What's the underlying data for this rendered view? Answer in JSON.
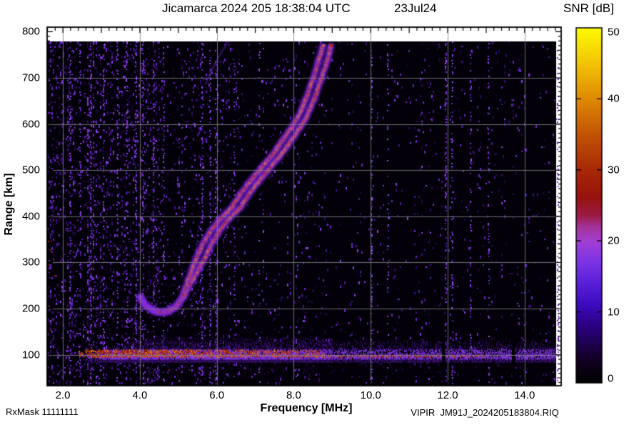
{
  "header": {
    "title": "Jicamarca 2024 205 18:38:04 UTC",
    "date": "23Jul24"
  },
  "footer": {
    "rx_mask": "RxMask 11111111",
    "file_label": "VIPIR  JM91J_2024205183804.RIQ"
  },
  "chart_data": {
    "type": "heatmap",
    "title": "Jicamarca 2024 205 18:38:04 UTC",
    "date_label": "23Jul24",
    "xlabel": "Frequency [MHz]",
    "ylabel": "Range [km]",
    "colorbar_label": "SNR [dB]",
    "xlim": [
      1.59,
      14.95
    ],
    "ylim": [
      33,
      810
    ],
    "clim": [
      0,
      50
    ],
    "grid": true,
    "x_tick_values": [
      2,
      4,
      6,
      8,
      10,
      12,
      14
    ],
    "x_tick_labels": [
      "2.0",
      "4.0",
      "6.0",
      "8.0",
      "10.0",
      "12.0",
      "14.0"
    ],
    "x_minor_tick_step": 0.2,
    "y_tick_values": [
      100,
      200,
      300,
      400,
      500,
      600,
      700,
      800
    ],
    "y_tick_labels": [
      "100",
      "200",
      "300",
      "400",
      "500",
      "600",
      "700",
      "800"
    ],
    "y_minor_tick_step": 10,
    "colorbar_tick_values": [
      0,
      10,
      20,
      30,
      40,
      50
    ],
    "colorbar_tick_labels": [
      "0",
      "10",
      "20",
      "30",
      "40",
      "50"
    ],
    "colormap_stops": [
      [
        0.0,
        "#000000"
      ],
      [
        0.07,
        "#140028"
      ],
      [
        0.16,
        "#2a0080"
      ],
      [
        0.22,
        "#3d0bbf"
      ],
      [
        0.28,
        "#5a1fd8"
      ],
      [
        0.34,
        "#7c34e6"
      ],
      [
        0.4,
        "#a23fd4"
      ],
      [
        0.44,
        "#a53296"
      ],
      [
        0.47,
        "#9c1c48"
      ],
      [
        0.52,
        "#96120e"
      ],
      [
        0.6,
        "#a92806"
      ],
      [
        0.7,
        "#c25404"
      ],
      [
        0.8,
        "#df8a04"
      ],
      [
        0.9,
        "#f3c406"
      ],
      [
        1.0,
        "#fdfb02"
      ]
    ],
    "data_extent": {
      "f_min": 1.59,
      "f_max": 14.87,
      "km_min": 33,
      "km_max": 778
    },
    "f_trace_center": [
      [
        4.0,
        228
      ],
      [
        4.15,
        207
      ],
      [
        4.35,
        196
      ],
      [
        4.55,
        192
      ],
      [
        4.75,
        195
      ],
      [
        4.95,
        205
      ],
      [
        5.1,
        222
      ],
      [
        5.25,
        250
      ],
      [
        5.4,
        278
      ],
      [
        5.55,
        305
      ],
      [
        5.75,
        340
      ],
      [
        5.95,
        368
      ],
      [
        6.15,
        390
      ],
      [
        6.3,
        402
      ],
      [
        6.5,
        420
      ],
      [
        6.7,
        445
      ],
      [
        6.9,
        468
      ],
      [
        7.1,
        488
      ],
      [
        7.3,
        508
      ],
      [
        7.5,
        528
      ],
      [
        7.7,
        550
      ],
      [
        7.9,
        575
      ],
      [
        8.08,
        595
      ],
      [
        8.25,
        620
      ],
      [
        8.38,
        645
      ],
      [
        8.5,
        672
      ],
      [
        8.62,
        700
      ],
      [
        8.73,
        730
      ],
      [
        8.82,
        755
      ],
      [
        8.88,
        774
      ]
    ],
    "trace_mode_split_mhz": 0.11,
    "trace_split_starts_km": 215,
    "e_layer": {
      "f_start": 2.4,
      "f_end": 14.87,
      "center_km": 101,
      "core_km_range": [
        96,
        112
      ],
      "halo_km_range": [
        87,
        140
      ],
      "strong_core_f_range": [
        2.7,
        4.8
      ],
      "core_visible_to_f": 8.8,
      "thin_line_km": 99,
      "notch_freqs": [
        11.88,
        13.7
      ]
    },
    "rfi_streaks": [
      {
        "f": 2.18,
        "s": 0.9
      },
      {
        "f": 2.45,
        "s": 0.6
      },
      {
        "f": 2.72,
        "s": 0.85
      },
      {
        "f": 3.05,
        "s": 0.6
      },
      {
        "f": 3.4,
        "s": 0.7
      },
      {
        "f": 3.65,
        "s": 0.55
      },
      {
        "f": 3.9,
        "s": 0.8
      },
      {
        "f": 4.08,
        "s": 0.7
      },
      {
        "f": 4.35,
        "s": 0.55
      },
      {
        "f": 4.62,
        "s": 0.5
      },
      {
        "f": 5.62,
        "s": 0.75
      },
      {
        "f": 5.82,
        "s": 0.85
      },
      {
        "f": 5.96,
        "s": 0.7
      },
      {
        "f": 6.45,
        "s": 0.4
      },
      {
        "f": 7.1,
        "s": 0.35
      },
      {
        "f": 10.02,
        "s": 0.75
      },
      {
        "f": 10.45,
        "s": 0.45
      },
      {
        "f": 11.95,
        "s": 0.65
      },
      {
        "f": 12.12,
        "s": 0.5
      },
      {
        "f": 12.6,
        "s": 0.55
      },
      {
        "f": 13.05,
        "s": 0.45
      },
      {
        "f": 14.86,
        "s": 0.6
      }
    ],
    "noise": {
      "dense_below_f": 4.6,
      "medium_below_f": 6.6,
      "sparse_above_f": 9.3
    },
    "oblique_echo": {
      "f_start": 5.7,
      "km_start": 685,
      "f_end": 6.3,
      "km_end": 785
    }
  }
}
